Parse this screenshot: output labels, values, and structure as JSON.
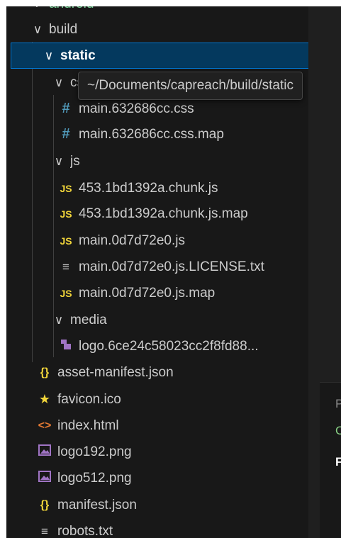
{
  "explorer": {
    "folders": {
      "android": "android",
      "build": "build",
      "static": "static",
      "css": "css",
      "js": "js",
      "media": "media"
    },
    "files": {
      "css_1": "main.632686cc.css",
      "css_2": "main.632686cc.css.map",
      "js_1": "453.1bd1392a.chunk.js",
      "js_2": "453.1bd1392a.chunk.js.map",
      "js_3": "main.0d7d72e0.js",
      "js_4": "main.0d7d72e0.js.LICENSE.txt",
      "js_5": "main.0d7d72e0.js.map",
      "media_1": "logo.6ce24c58023cc2f8fd88...",
      "asset_manifest": "asset-manifest.json",
      "favicon": "favicon.ico",
      "index_html": "index.html",
      "logo192": "logo192.png",
      "logo512": "logo512.png",
      "manifest": "manifest.json",
      "robots": "robots.txt"
    },
    "tooltip": "~/Documents/capreach/build/static"
  },
  "icons": {
    "css_glyph": "#",
    "js_glyph": "JS",
    "json_glyph": "{}",
    "html_glyph": "<>",
    "star_glyph": "★",
    "txt_glyph": "≡",
    "chevron_down": "∨",
    "chevron_right": "›"
  },
  "editor_panel": {
    "line_1": "P",
    "line_2": "C",
    "line_3": "F"
  },
  "colors": {
    "selection_bg": "#04395e",
    "selection_border": "#0078d4",
    "sidebar_bg": "#181818",
    "css_icon": "#519aba",
    "js_icon": "#f1d53a",
    "html_icon": "#e37933",
    "image_icon": "#a074c4"
  }
}
